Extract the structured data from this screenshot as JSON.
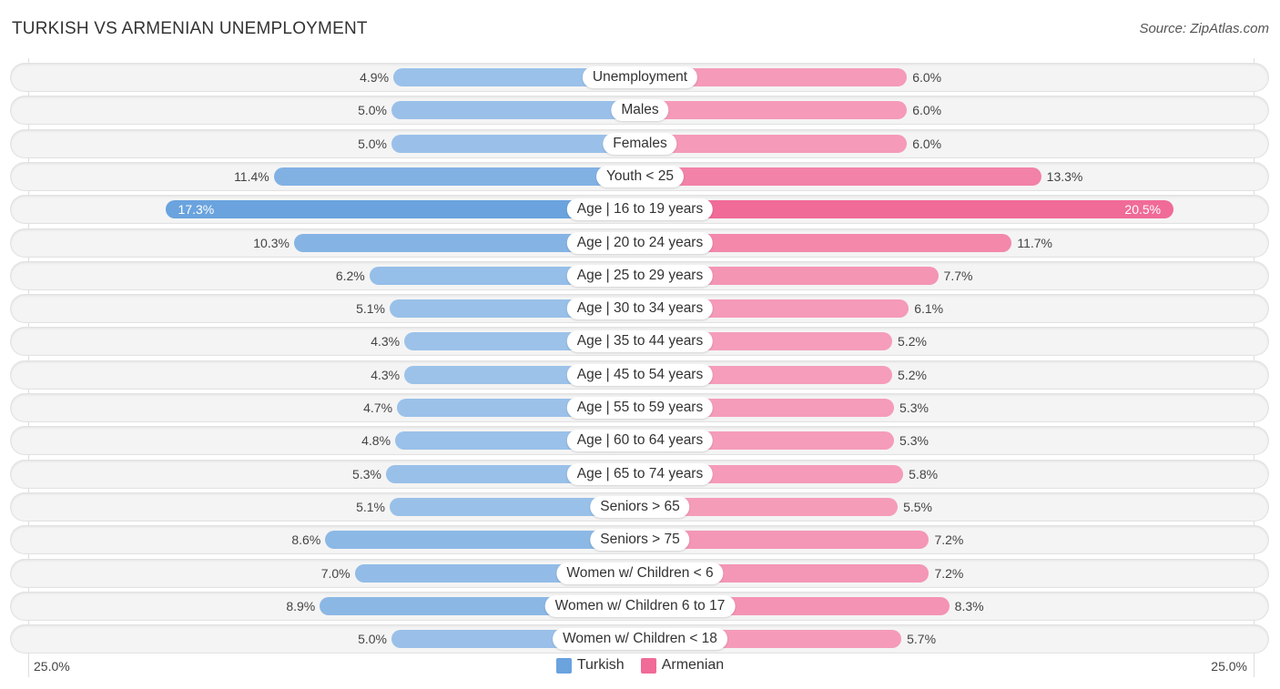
{
  "header": {
    "title": "TURKISH VS ARMENIAN UNEMPLOYMENT",
    "source": "Source: ZipAtlas.com"
  },
  "legend": {
    "items": [
      {
        "name": "Turkish",
        "color": "#6aa3de"
      },
      {
        "name": "Armenian",
        "color": "#f06b97"
      }
    ]
  },
  "axis": {
    "left_label": "25.0%",
    "right_label": "25.0%"
  },
  "chart_data": {
    "type": "bar",
    "orientation": "horizontal-diverging",
    "title": "TURKISH VS ARMENIAN UNEMPLOYMENT",
    "xlabel": "",
    "ylabel": "",
    "xlim": [
      0,
      25
    ],
    "unit": "%",
    "legend_position": "bottom-center",
    "categories": [
      "Unemployment",
      "Males",
      "Females",
      "Youth < 25",
      "Age | 16 to 19 years",
      "Age | 20 to 24 years",
      "Age | 25 to 29 years",
      "Age | 30 to 34 years",
      "Age | 35 to 44 years",
      "Age | 45 to 54 years",
      "Age | 55 to 59 years",
      "Age | 60 to 64 years",
      "Age | 65 to 74 years",
      "Seniors > 65",
      "Seniors > 75",
      "Women w/ Children < 6",
      "Women w/ Children 6 to 17",
      "Women w/ Children < 18"
    ],
    "series": [
      {
        "name": "Turkish",
        "color": "#6aa3de",
        "values": [
          4.9,
          5.0,
          5.0,
          11.4,
          17.3,
          10.3,
          6.2,
          5.1,
          4.3,
          4.3,
          4.7,
          4.8,
          5.3,
          5.1,
          8.6,
          7.0,
          8.9,
          5.0
        ],
        "labels": [
          "4.9%",
          "5.0%",
          "5.0%",
          "11.4%",
          "17.3%",
          "10.3%",
          "6.2%",
          "5.1%",
          "4.3%",
          "4.3%",
          "4.7%",
          "4.8%",
          "5.3%",
          "5.1%",
          "8.6%",
          "7.0%",
          "8.9%",
          "5.0%"
        ]
      },
      {
        "name": "Armenian",
        "color": "#f06b97",
        "values": [
          6.0,
          6.0,
          6.0,
          13.3,
          20.5,
          11.7,
          7.7,
          6.1,
          5.2,
          5.2,
          5.3,
          5.3,
          5.8,
          5.5,
          7.2,
          7.2,
          8.3,
          5.7
        ],
        "labels": [
          "6.0%",
          "6.0%",
          "6.0%",
          "13.3%",
          "20.5%",
          "11.7%",
          "7.7%",
          "6.1%",
          "5.2%",
          "5.2%",
          "5.3%",
          "5.3%",
          "5.8%",
          "5.5%",
          "7.2%",
          "7.2%",
          "8.3%",
          "5.7%"
        ]
      }
    ]
  }
}
